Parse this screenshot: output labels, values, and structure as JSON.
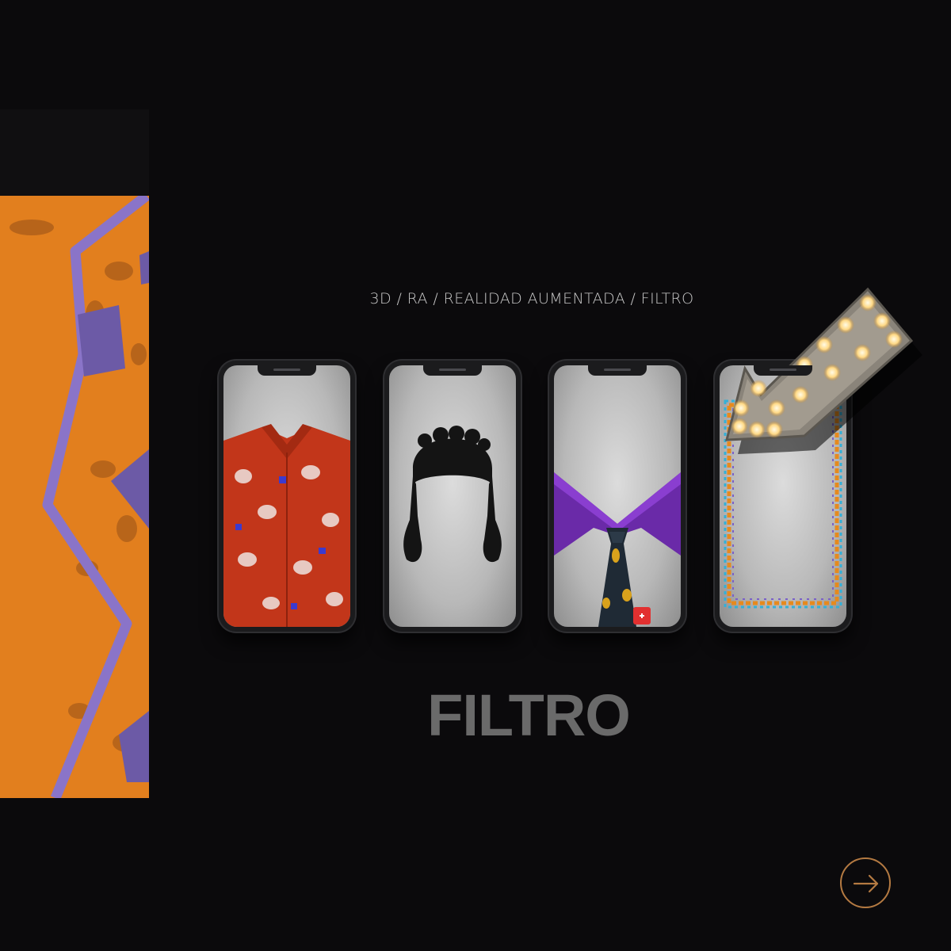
{
  "tags": "3D / RA / REALIDAD AUMENTADA / FILTRO",
  "title": "FILTRO",
  "phones": [
    {
      "label": "shirt-filter"
    },
    {
      "label": "hair-filter"
    },
    {
      "label": "collar-tie-filter"
    },
    {
      "label": "frame-filter"
    }
  ],
  "colors": {
    "background": "#0b0a0c",
    "panel_orange": "#e27f1e",
    "panel_purple": "#8a74c8",
    "title_gray": "#6a6a6a",
    "accent_copper": "#b47a42"
  },
  "icons": {
    "next": "arrow-right-icon",
    "sign": "marquee-arrow-icon"
  }
}
